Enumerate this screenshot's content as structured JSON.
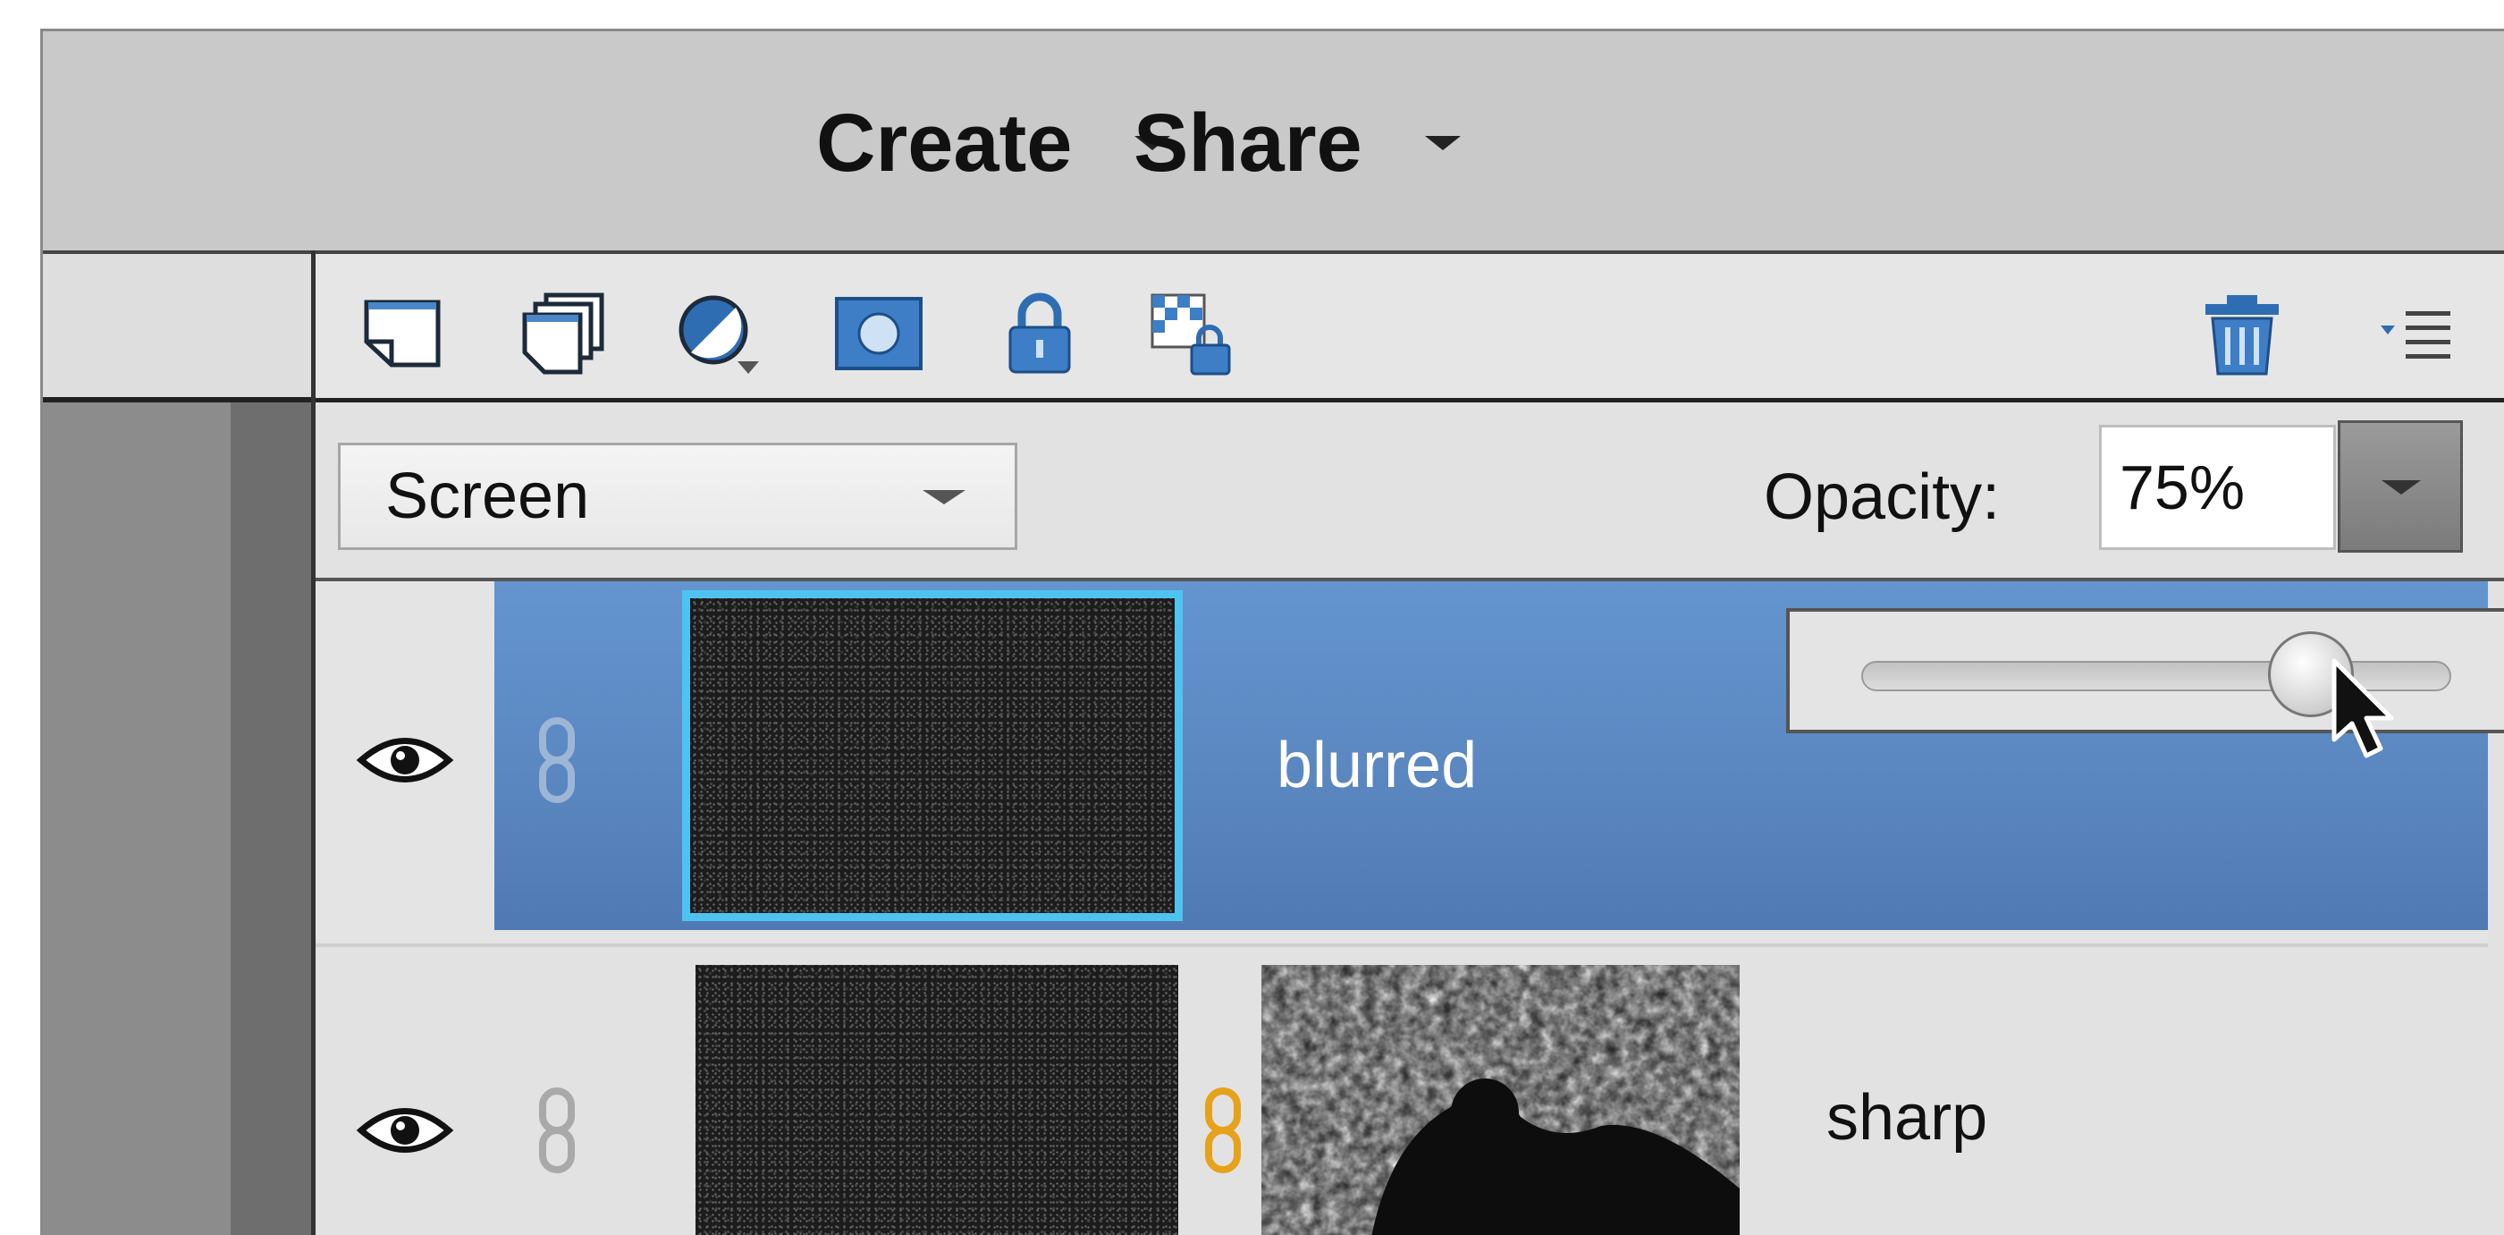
{
  "menu": {
    "create_label": "Create",
    "share_label": "Share"
  },
  "toolbar": {
    "icons": [
      "new-layer-icon",
      "new-group-icon",
      "adjustment-layer-icon",
      "layer-mask-icon",
      "lock-all-icon",
      "lock-transparency-icon",
      "trash-icon",
      "panel-menu-icon"
    ]
  },
  "options": {
    "blend_mode": "Screen",
    "opacity_label": "Opacity:",
    "opacity_value": "75%",
    "opacity_slider_fraction": 0.75
  },
  "layers": [
    {
      "name": "blurred",
      "selected": true,
      "visible": true
    },
    {
      "name": "sharp",
      "selected": false,
      "visible": true
    }
  ],
  "colors": {
    "selection": "#5a86bf",
    "thumb_highlight": "#4fc3f0",
    "mask_link": "#e6a21a"
  }
}
